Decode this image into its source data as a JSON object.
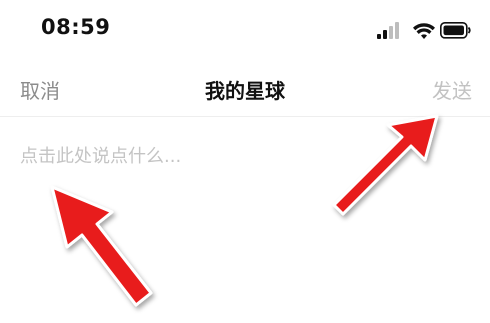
{
  "status_bar": {
    "time": "08:59",
    "signal_icon": "cellular-signal-icon",
    "wifi_icon": "wifi-icon",
    "battery_icon": "battery-icon"
  },
  "nav": {
    "cancel_label": "取消",
    "title": "我的星球",
    "send_label": "发送"
  },
  "composer": {
    "value": "",
    "placeholder": "点击此处说点什么..."
  },
  "annotations": {
    "arrow_color": "#e81c1c",
    "arrows": [
      "arrow-to-send",
      "arrow-to-input"
    ]
  }
}
